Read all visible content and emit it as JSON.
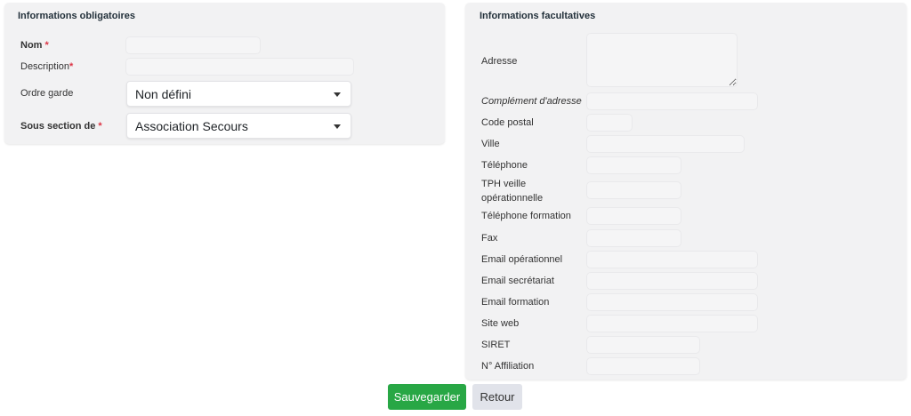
{
  "left_panel": {
    "title": "Informations obligatoires",
    "nom_label": "Nom",
    "description_label": "Description",
    "ordre_garde_label": "Ordre garde",
    "ordre_garde_value": "Non défini",
    "sous_section_label": "Sous section de",
    "sous_section_value": "Association Secours",
    "required_mark": "*"
  },
  "right_panel": {
    "title": "Informations facultatives",
    "adresse": "Adresse",
    "complement": "Complément d'adresse",
    "code_postal": "Code postal",
    "ville": "Ville",
    "telephone": "Téléphone",
    "tph_veille_1": "TPH veille",
    "tph_veille_2": "opérationnelle",
    "telephone_formation": "Téléphone formation",
    "fax": "Fax",
    "email_operationnel": "Email opérationnel",
    "email_secretariat": "Email secrétariat",
    "email_formation": "Email formation",
    "site_web": "Site web",
    "siret": "SIRET",
    "affiliation": "N° Affiliation"
  },
  "actions": {
    "save_label": "Sauvegarder",
    "back_label": "Retour"
  },
  "colors": {
    "panel_bg": "#f2f2f3",
    "save_bg": "#28a745",
    "back_bg": "#e1e3ea",
    "required": "#dc3545"
  }
}
